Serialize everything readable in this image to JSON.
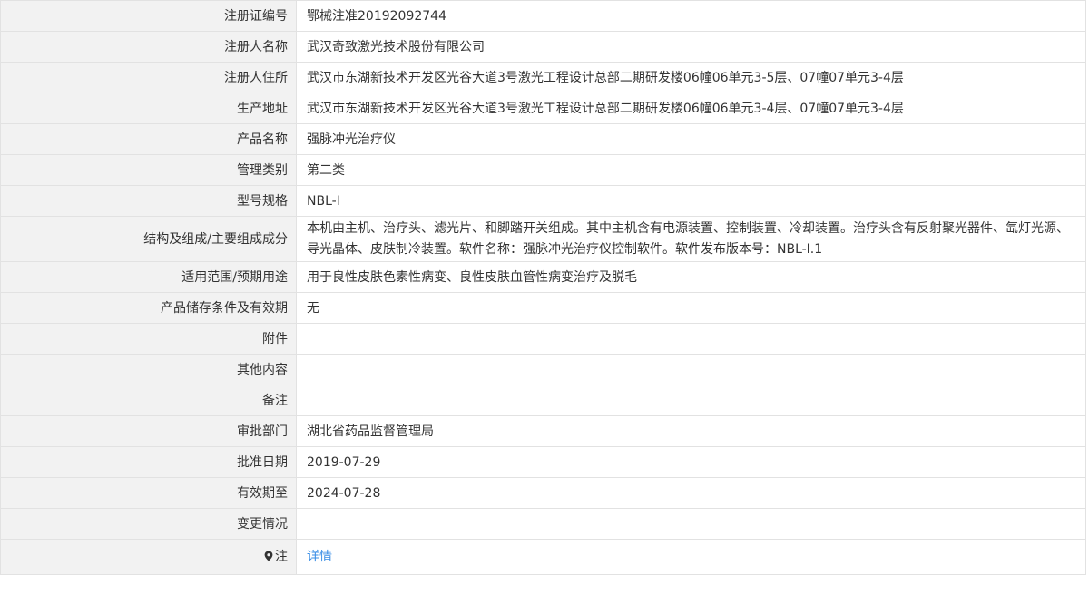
{
  "rows": [
    {
      "name": "registration-number",
      "label": "注册证编号",
      "value": "鄂械注准20192092744"
    },
    {
      "name": "registrant-name",
      "label": "注册人名称",
      "value": "武汉奇致激光技术股份有限公司"
    },
    {
      "name": "registrant-address",
      "label": "注册人住所",
      "value": "武汉市东湖新技术开发区光谷大道3号激光工程设计总部二期研发楼06幢06单元3-5层、07幢07单元3-4层"
    },
    {
      "name": "production-address",
      "label": "生产地址",
      "value": "武汉市东湖新技术开发区光谷大道3号激光工程设计总部二期研发楼06幢06单元3-4层、07幢07单元3-4层"
    },
    {
      "name": "product-name",
      "label": "产品名称",
      "value": "强脉冲光治疗仪"
    },
    {
      "name": "management-category",
      "label": "管理类别",
      "value": "第二类"
    },
    {
      "name": "model-spec",
      "label": "型号规格",
      "value": "NBL-Ⅰ"
    },
    {
      "name": "structure-composition",
      "label": "结构及组成/主要组成成分",
      "value": "本机由主机、治疗头、滤光片、和脚踏开关组成。其中主机含有电源装置、控制装置、冷却装置。治疗头含有反射聚光器件、氙灯光源、导光晶体、皮肤制冷装置。软件名称：强脉冲光治疗仪控制软件。软件发布版本号：NBL-Ⅰ.1"
    },
    {
      "name": "intended-use",
      "label": "适用范围/预期用途",
      "value": "用于良性皮肤色素性病变、良性皮肤血管性病变治疗及脱毛"
    },
    {
      "name": "storage-validity",
      "label": "产品储存条件及有效期",
      "value": "无"
    },
    {
      "name": "attachment",
      "label": "附件",
      "value": ""
    },
    {
      "name": "other-content",
      "label": "其他内容",
      "value": ""
    },
    {
      "name": "remarks",
      "label": "备注",
      "value": ""
    },
    {
      "name": "approval-department",
      "label": "审批部门",
      "value": "湖北省药品监督管理局"
    },
    {
      "name": "approval-date",
      "label": "批准日期",
      "value": "2019-07-29"
    },
    {
      "name": "valid-until",
      "label": "有效期至",
      "value": "2024-07-28"
    },
    {
      "name": "change-status",
      "label": "变更情况",
      "value": ""
    }
  ],
  "note_row": {
    "label": "注",
    "icon": "map-pin-icon",
    "link_text": "详情",
    "link_color": "#3a8ee6"
  }
}
